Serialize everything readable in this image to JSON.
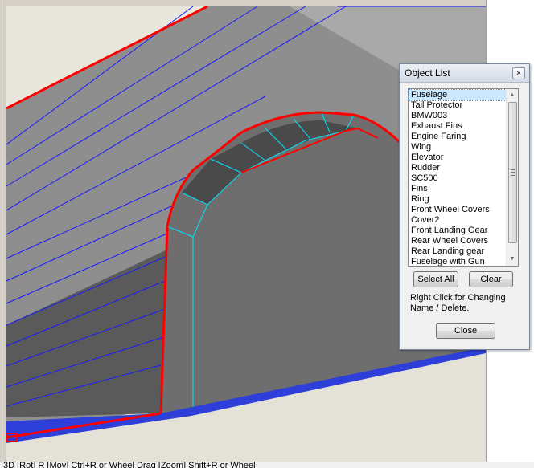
{
  "dialog": {
    "title": "Object List",
    "close_glyph": "✕",
    "items": [
      "Fuselage",
      "Tail Protector",
      "BMW003",
      "Exhaust Fins",
      "Engine Faring",
      "Wing",
      "Elevator",
      "Rudder",
      "SC500",
      "Fins",
      "Ring",
      "Front Wheel Covers",
      "Cover2",
      "Front Landing Gear",
      "Rear Wheel Covers",
      "Rear Landing gear",
      "Fuselage with Gun"
    ],
    "selected_index": 0,
    "select_all_label": "Select All",
    "clear_label": "Clear",
    "hint": "Right Click for Changing Name / Delete.",
    "close_label": "Close"
  },
  "status_bar": "3D [Rot] R [Mov] Ctrl+R or Wheel Drag [Zoom] Shift+R or Wheel",
  "colors": {
    "selection_edge": "#ff0000",
    "mesh_line": "#1a1aff",
    "vertex_edge": "#00e5ff",
    "panel_dark": "#4a4a4a",
    "panel_face": "#6e6e6e"
  }
}
